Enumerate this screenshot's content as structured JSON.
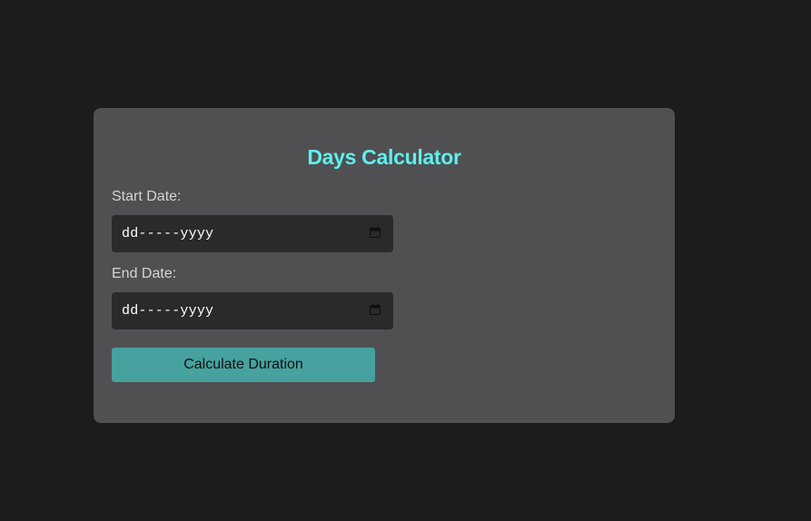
{
  "app": {
    "title": "Days Calculator"
  },
  "form": {
    "start_label": "Start Date:",
    "start_value": "dd-----yyyy",
    "end_label": "End Date:",
    "end_value": "dd-----yyyy",
    "submit_label": "Calculate Duration"
  },
  "icons": {
    "date_picker": "calendar-icon"
  },
  "colors": {
    "page_background": "#1c1c1e",
    "card_background": "#505052",
    "title": "#5ef0ee",
    "field_background": "#2a2a2b",
    "button_background": "#47a19e"
  }
}
